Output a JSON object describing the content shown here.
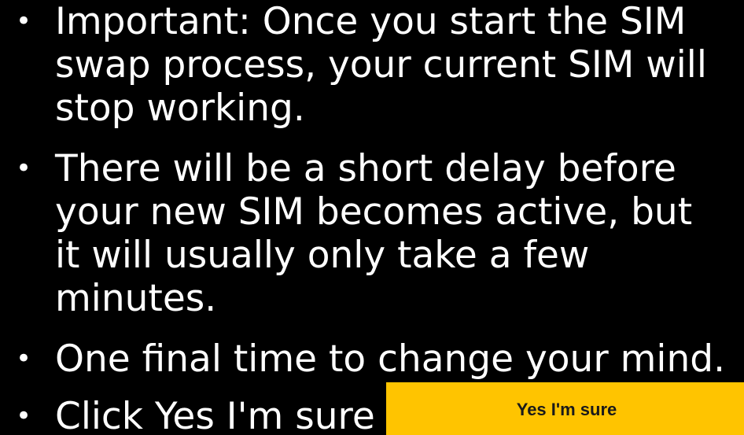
{
  "instructions": {
    "items": [
      {
        "lines": [
          "Important: Once you start the SIM",
          "swap process, your current SIM will",
          "stop working."
        ]
      },
      {
        "lines": [
          "There will be a short delay before",
          "your new SIM becomes active, but",
          "it will usually only take a few",
          "minutes."
        ]
      },
      {
        "lines": [
          "One final time to change your mind."
        ]
      },
      {
        "lines": [
          "Click Yes I'm sure"
        ]
      }
    ],
    "bullet_glyph": "•"
  },
  "confirm_button": {
    "label": "Yes I'm sure",
    "background_color": "#ffc400",
    "text_color": "#1a1a1a"
  },
  "colors": {
    "background": "#000000",
    "text": "#ffffff"
  }
}
